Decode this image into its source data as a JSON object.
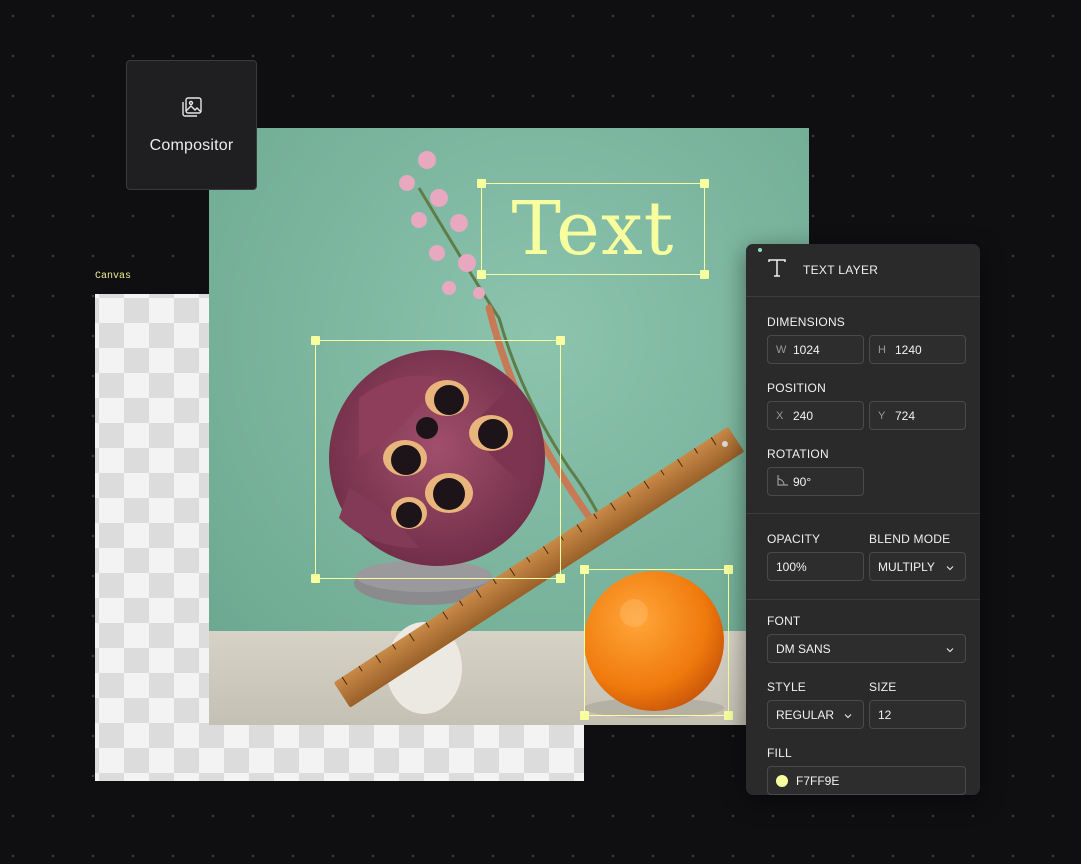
{
  "compositor": {
    "label": "Compositor",
    "icon": "image-stack-icon"
  },
  "canvas": {
    "label": "Canvas"
  },
  "text_layer_content": "Text",
  "accent_color": "#f7ff9e",
  "panel": {
    "title": "TEXT LAYER",
    "title_icon": "text-type-icon",
    "dimensions": {
      "label": "DIMENSIONS",
      "w_prefix": "W",
      "w": "1024",
      "h_prefix": "H",
      "h": "1240"
    },
    "position": {
      "label": "POSITION",
      "x_prefix": "X",
      "x": "240",
      "y_prefix": "Y",
      "y": "724"
    },
    "rotation": {
      "label": "ROTATION",
      "value": "90°",
      "icon": "angle-icon"
    },
    "opacity": {
      "label": "OPACITY",
      "value": "100%"
    },
    "blend_mode": {
      "label": "BLEND MODE",
      "value": "MULTIPLY"
    },
    "font": {
      "label": "FONT",
      "value": "DM SANS"
    },
    "style": {
      "label": "STYLE",
      "value": "REGULAR"
    },
    "size": {
      "label": "SIZE",
      "value": "12"
    },
    "fill": {
      "label": "FILL",
      "value": "F7FF9E",
      "swatch": "#f7ff9e"
    }
  }
}
